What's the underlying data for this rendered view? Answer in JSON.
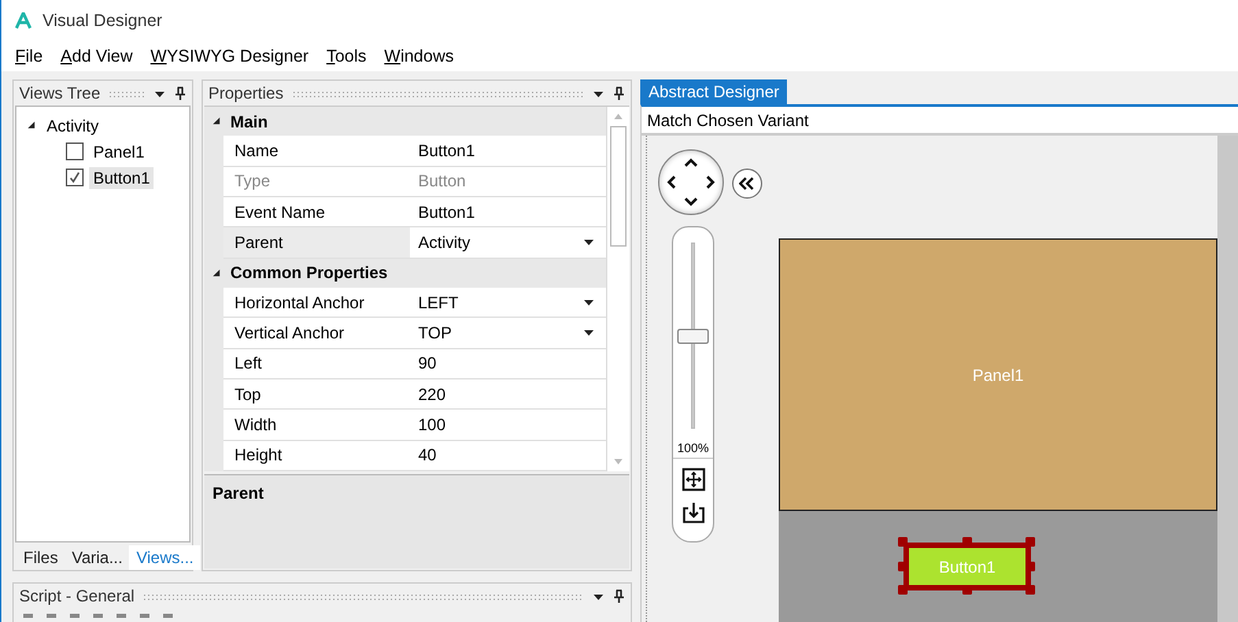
{
  "window": {
    "title": "Visual Designer"
  },
  "menu": [
    {
      "label": "File"
    },
    {
      "label": "Add View"
    },
    {
      "label": "WYSIWYG Designer"
    },
    {
      "label": "Tools"
    },
    {
      "label": "Windows"
    }
  ],
  "views_tree": {
    "title": "Views Tree",
    "items": [
      {
        "label": "Activity",
        "expanded": true,
        "children": [
          {
            "label": "Panel1",
            "checked": false,
            "selected": false
          },
          {
            "label": "Button1",
            "checked": true,
            "selected": true
          }
        ]
      }
    ],
    "tabs": [
      {
        "label": "Files",
        "selected": false
      },
      {
        "label": "Varia...",
        "selected": false
      },
      {
        "label": "Views...",
        "selected": true
      }
    ]
  },
  "properties": {
    "title": "Properties",
    "categories": [
      {
        "label": "Main",
        "expanded": true,
        "rows": [
          {
            "name": "Name",
            "value": "Button1",
            "kind": "text",
            "disabled": false,
            "selected": false
          },
          {
            "name": "Type",
            "value": "Button",
            "kind": "text",
            "disabled": true,
            "selected": false
          },
          {
            "name": "Event Name",
            "value": "Button1",
            "kind": "text",
            "disabled": false,
            "selected": false
          },
          {
            "name": "Parent",
            "value": "Activity",
            "kind": "dropdown",
            "disabled": false,
            "selected": true
          }
        ]
      },
      {
        "label": "Common Properties",
        "expanded": true,
        "rows": [
          {
            "name": "Horizontal Anchor",
            "value": "LEFT",
            "kind": "dropdown",
            "disabled": false,
            "selected": false
          },
          {
            "name": "Vertical Anchor",
            "value": "TOP",
            "kind": "dropdown",
            "disabled": false,
            "selected": false
          },
          {
            "name": "Left",
            "value": "90",
            "kind": "text",
            "disabled": false,
            "selected": false
          },
          {
            "name": "Top",
            "value": "220",
            "kind": "text",
            "disabled": false,
            "selected": false
          },
          {
            "name": "Width",
            "value": "100",
            "kind": "text",
            "disabled": false,
            "selected": false
          },
          {
            "name": "Height",
            "value": "40",
            "kind": "text",
            "disabled": false,
            "selected": false
          }
        ]
      }
    ],
    "description": {
      "title": "Parent"
    }
  },
  "designer": {
    "tab": {
      "label": "Abstract Designer",
      "selected": true
    },
    "variant": "Match Chosen Variant",
    "zoom": {
      "level": 0.5,
      "reading": "100%"
    },
    "views": [
      {
        "kind": "panel",
        "label": "Panel1",
        "selected": false
      },
      {
        "kind": "button",
        "label": "Button1",
        "selected": true
      }
    ]
  },
  "script": {
    "title": "Script - General"
  }
}
